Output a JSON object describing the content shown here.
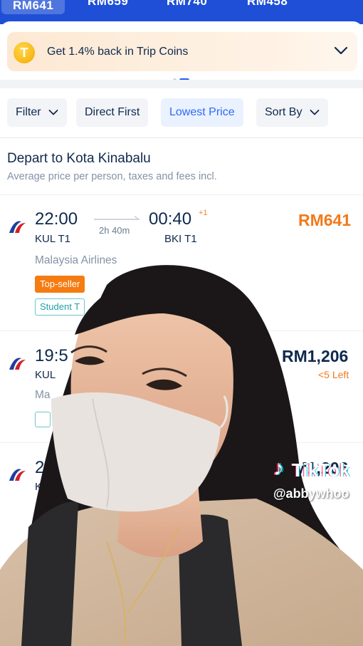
{
  "date_strip": {
    "tabs": [
      {
        "label": "RM641",
        "selected": true
      },
      {
        "label": "RM659",
        "selected": false
      },
      {
        "label": "RM740",
        "selected": false
      },
      {
        "label": "RM458",
        "selected": false
      }
    ]
  },
  "trip_coins": {
    "icon_letter": "T",
    "text": "Get 1.4% back in Trip Coins",
    "chevron_icon": "chevron-down-icon"
  },
  "filters": {
    "filter_label": "Filter",
    "direct_first_label": "Direct First",
    "lowest_price_label": "Lowest Price",
    "sort_by_label": "Sort By"
  },
  "section": {
    "title": "Depart to Kota Kinabalu",
    "subtitle": "Average price per person, taxes and fees incl."
  },
  "flights": [
    {
      "depart_time": "22:00",
      "depart_airport": "KUL T1",
      "duration": "2h 40m",
      "arrive_time": "00:40",
      "day_offset": "+1",
      "arrive_airport": "BKI T1",
      "price": "RM641",
      "airline": "Malaysia Airlines",
      "tags": [
        "Top-seller",
        "Student T"
      ]
    },
    {
      "depart_time": "19:5",
      "depart_airport": "KUL",
      "price": "RM1,206",
      "seats_left": "<5 Left",
      "airline": "Ma"
    },
    {
      "depart_time": "21",
      "depart_airport": "KUL",
      "price": "RM1,206"
    }
  ],
  "watermark": {
    "brand": "TikTok",
    "handle": "@abbywhoo"
  },
  "colors": {
    "accent_blue": "#2d6bf6",
    "price_orange": "#f27a1a",
    "header_blue": "#1e4fd6"
  }
}
